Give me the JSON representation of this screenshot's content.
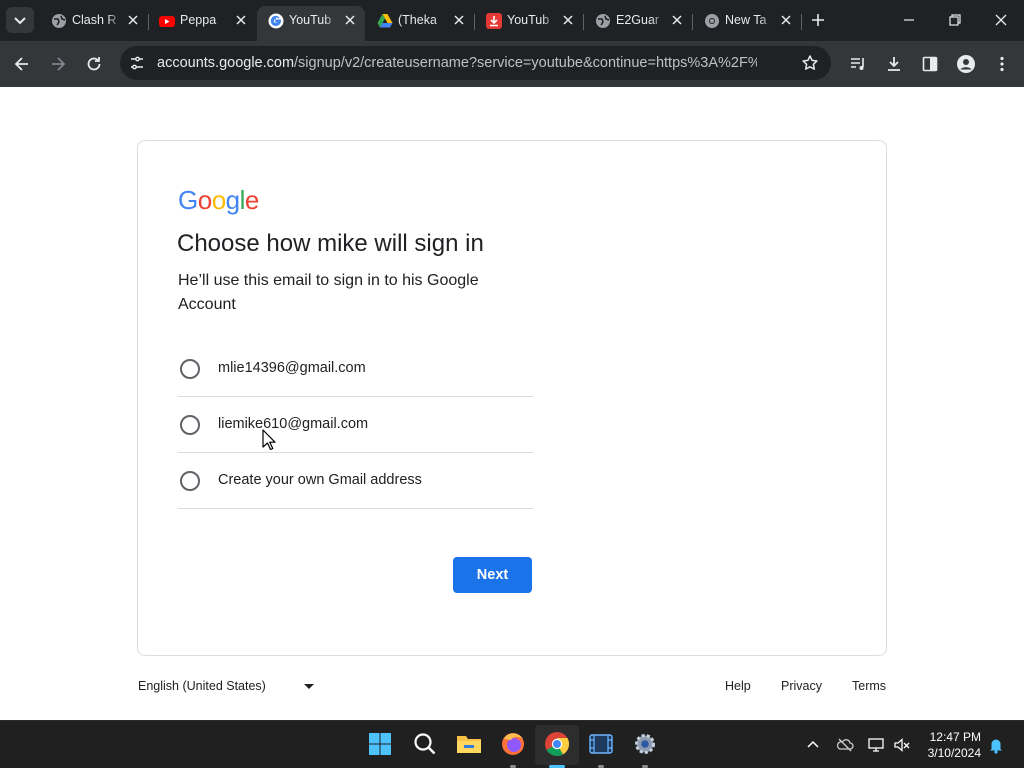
{
  "browser": {
    "tabs": [
      {
        "title": "Clash R",
        "icon": "globe-icon"
      },
      {
        "title": "Peppa",
        "icon": "youtube-icon"
      },
      {
        "title": "YouTub",
        "icon": "google-icon",
        "active": true
      },
      {
        "title": "(Theka",
        "icon": "drive-icon"
      },
      {
        "title": "YouTub",
        "icon": "download-red-icon"
      },
      {
        "title": "E2Guar",
        "icon": "globe-icon"
      },
      {
        "title": "New Ta",
        "icon": "chrome-icon"
      }
    ],
    "url_host": "accounts.google.com",
    "url_path": "/signup/v2/createusername?service=youtube&continue=https%3A%2F%2Fww..."
  },
  "page": {
    "logo_text": "Google",
    "heading": "Choose how mike will sign in",
    "subtext": "He’ll use this email to sign in to his Google Account",
    "options": [
      {
        "label": "mlie14396@gmail.com"
      },
      {
        "label": "liemike610@gmail.com"
      },
      {
        "label": "Create your own Gmail address"
      }
    ],
    "next_label": "Next"
  },
  "footer": {
    "language": "English (United States)",
    "links": [
      "Help",
      "Privacy",
      "Terms"
    ]
  },
  "taskbar": {
    "time": "12:47 PM",
    "date": "3/10/2024"
  }
}
